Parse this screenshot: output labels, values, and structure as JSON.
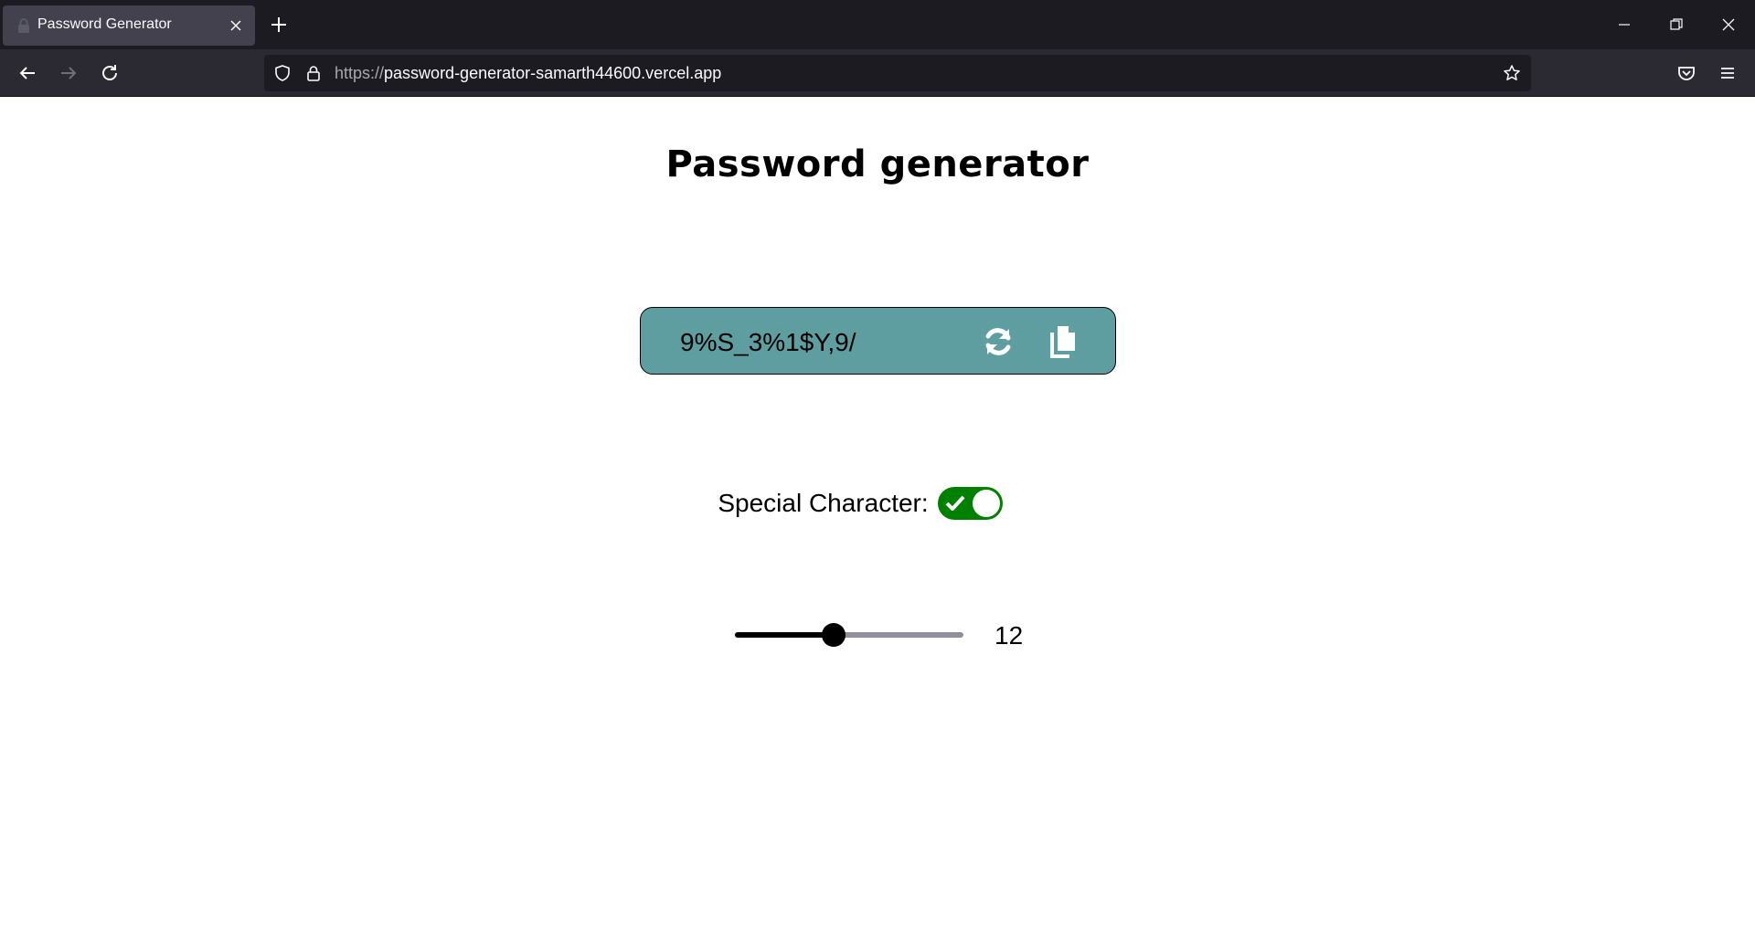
{
  "browser": {
    "tab_title": "Password Generator",
    "url_scheme": "https://",
    "url_host": "password-generator-samarth44600.vercel.app"
  },
  "page": {
    "title": "Password generator",
    "password": "9%S_3%1$Y,9/",
    "special_label": "Special Character:",
    "special_enabled": true,
    "length_value": "12",
    "length_fraction": 0.43
  },
  "colors": {
    "password_box": "#5f9ea0",
    "toggle_on": "#008000"
  },
  "icons": {
    "refresh": "refresh-icon",
    "copy": "copy-icon"
  }
}
